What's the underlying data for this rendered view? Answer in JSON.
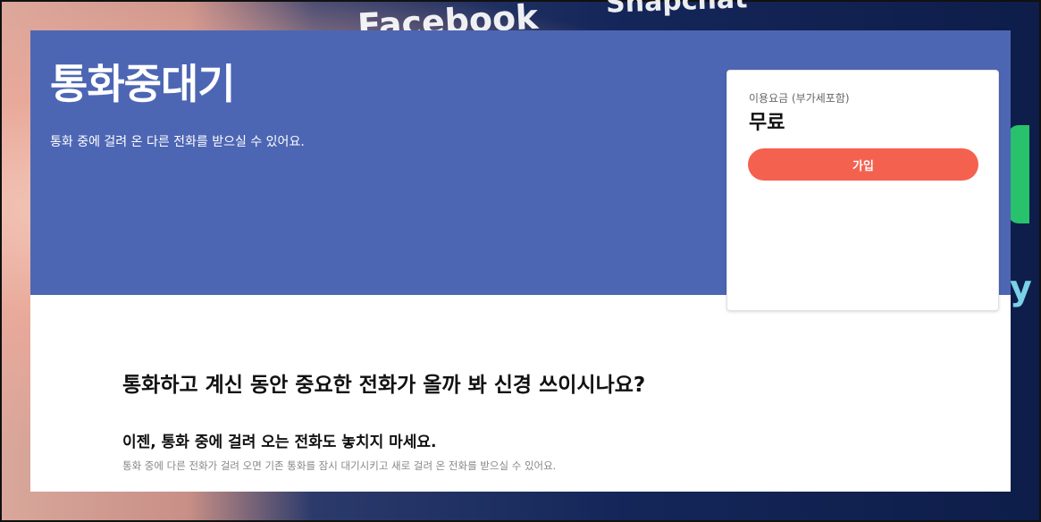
{
  "background": {
    "text_facebook": "Facebook",
    "text_snapchat": "Snapchat",
    "text_partial": "y"
  },
  "hero": {
    "title": "통화중대기",
    "subtitle": "통화 중에 걸려 온 다른 전화를 받으실 수 있어요."
  },
  "pricing": {
    "label": "이용요금 (부가세포함)",
    "value": "무료",
    "join_label": "가입"
  },
  "content": {
    "heading": "통화하고 계신 동안 중요한 전화가 올까 봐 신경 쓰이시나요?",
    "subheading": "이젠, 통화 중에 걸려 오는 전화도 놓치지 마세요.",
    "description": "통화 중에 다른 전화가 걸려 오면 기존 통화를 잠시 대기시키고 새로 걸려 온 전화를 받으실 수 있어요."
  },
  "colors": {
    "hero_bg": "#4d66b4",
    "accent_button": "#f5614f"
  }
}
